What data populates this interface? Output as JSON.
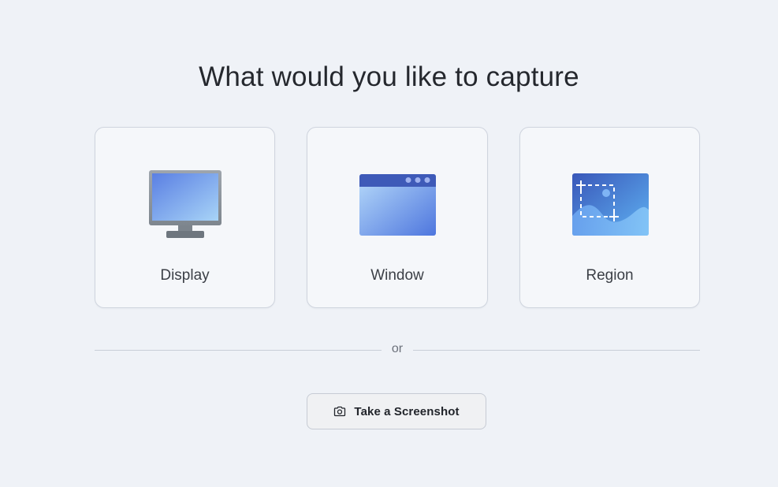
{
  "heading": "What would you like to capture",
  "options": [
    {
      "label": "Display",
      "icon": "monitor-icon"
    },
    {
      "label": "Window",
      "icon": "window-icon"
    },
    {
      "label": "Region",
      "icon": "region-select-icon"
    }
  ],
  "divider_text": "or",
  "screenshot_button": {
    "label": "Take a Screenshot",
    "icon": "camera-icon"
  },
  "colors": {
    "background": "#eff2f7",
    "card_background": "#f5f7fa",
    "card_border": "#cfd4de",
    "accent_blue": "#4a73db"
  }
}
